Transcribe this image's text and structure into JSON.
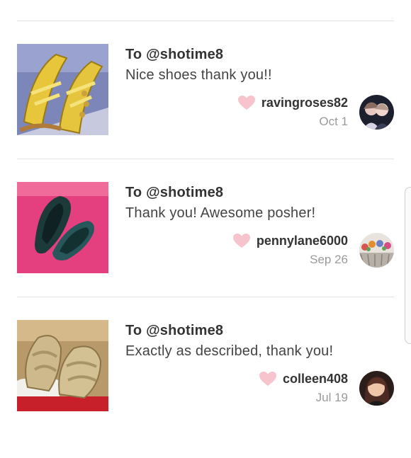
{
  "reviews": [
    {
      "to": "To @shotime8",
      "message": "Nice shoes thank you!!",
      "username": "ravingroses82",
      "date": "Oct 1",
      "thumb_icon": "yellow-sandals-photo",
      "avatar_icon": "two-people-photo"
    },
    {
      "to": "To @shotime8",
      "message": "Thank you! Awesome posher!",
      "username": "pennylane6000",
      "date": "Sep 26",
      "thumb_icon": "green-flats-photo",
      "avatar_icon": "flower-crown-photo"
    },
    {
      "to": "To @shotime8",
      "message": "Exactly as described, thank you!",
      "username": "colleen408",
      "date": "Jul 19",
      "thumb_icon": "tan-sandals-photo",
      "avatar_icon": "woman-portrait-photo"
    }
  ],
  "colors": {
    "heart": "#f7c3cc",
    "divider": "#e3e3e3",
    "date": "#9a9a9a"
  }
}
